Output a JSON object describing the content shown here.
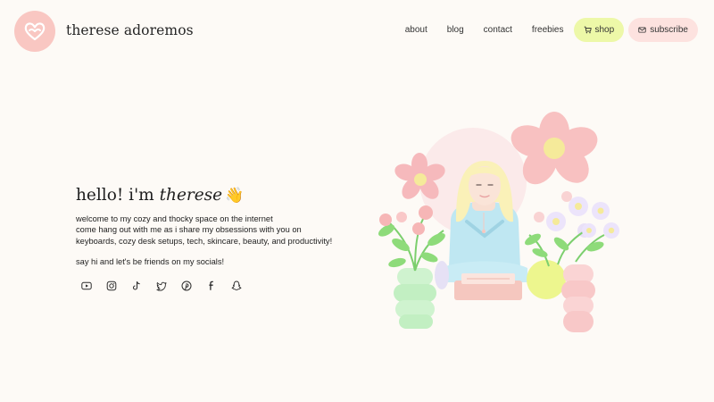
{
  "header": {
    "logo_icon": "heart-hands-icon",
    "site_title": "therese adoremos",
    "nav": [
      {
        "label": "about"
      },
      {
        "label": "blog"
      },
      {
        "label": "contact"
      },
      {
        "label": "freebies"
      }
    ],
    "shop": {
      "label": "shop",
      "icon": "cart-icon"
    },
    "subscribe": {
      "label": "subscribe",
      "icon": "mail-icon"
    }
  },
  "hero": {
    "greeting_prefix": "hello! i'm",
    "greeting_name": "therese",
    "greeting_emoji": "👋",
    "intro_lines": [
      "welcome to my cozy and thocky space on the internet",
      "come hang out with me as i share my obsessions with you on",
      "keyboards, cozy desk setups, tech, skincare, beauty, and productivity!"
    ],
    "socials_text": "say hi and let's be friends on my socials!",
    "social_icons": [
      "youtube-icon",
      "instagram-icon",
      "tiktok-icon",
      "twitter-icon",
      "pinterest-icon",
      "facebook-icon",
      "snapchat-icon"
    ]
  },
  "colors": {
    "background": "#fdfaf6",
    "logo_pink": "#f9c7c2",
    "shop_green": "#edf8a8",
    "subscribe_pink": "#fde2df"
  }
}
